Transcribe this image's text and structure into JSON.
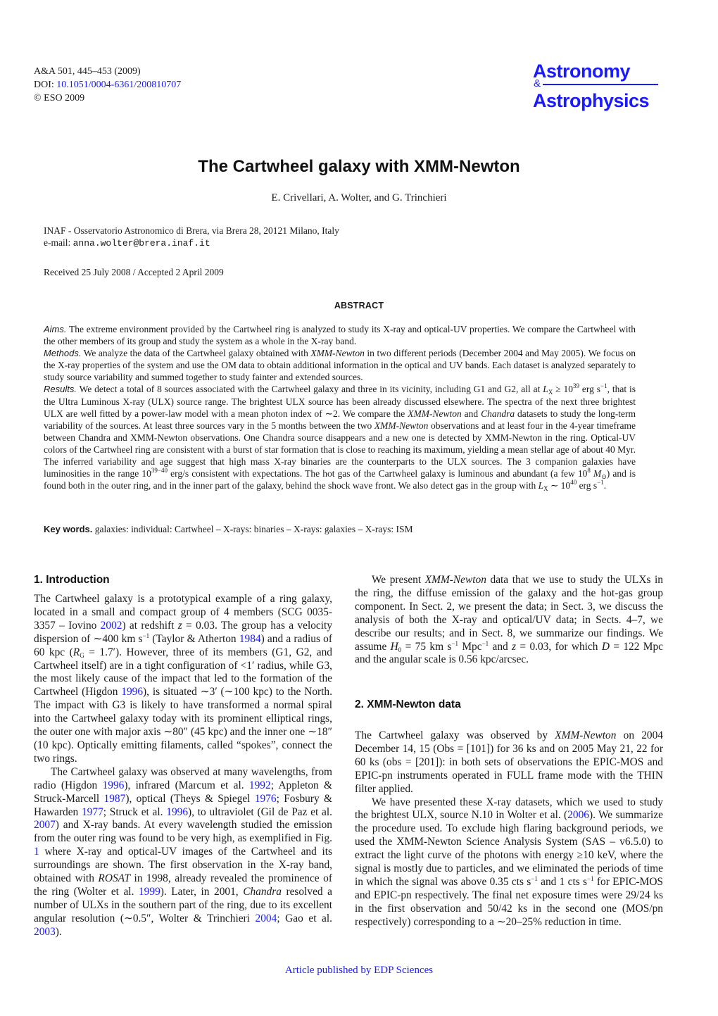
{
  "header": {
    "citation": "A&A 501, 445–453 (2009)",
    "doi_label": "DOI: ",
    "doi_link": "10.1051/0004-6361/200810707",
    "copyright": "© ESO 2009"
  },
  "journal_logo": {
    "line1": "Astronomy",
    "ampersand": "&",
    "line2": "Astrophysics",
    "color": "#1a1aff"
  },
  "paper": {
    "title": "The Cartwheel galaxy with XMM-Newton",
    "authors": "E. Crivellari, A. Wolter, and G. Trinchieri",
    "affiliation": "INAF - Osservatorio Astronomico di Brera, via Brera 28, 20121 Milano, Italy",
    "email_label": "e-mail: ",
    "email": "anna.wolter@brera.inaf.it",
    "received": "Received 25 July 2008 / Accepted 2 April 2009"
  },
  "abstract": {
    "heading": "ABSTRACT",
    "aims_label": "Aims.",
    "aims": "The extreme environment provided by the Cartwheel ring is analyzed to study its X-ray and optical-UV properties. We compare the Cartwheel with the other members of its group and study the system as a whole in the X-ray band.",
    "methods_label": "Methods.",
    "methods_a": "We analyze the data of the Cartwheel galaxy obtained with ",
    "methods_it": "XMM-Newton",
    "methods_b": " in two different periods (December 2004 and May 2005). We focus on the X-ray properties of the system and use the OM data to obtain additional information in the optical and UV bands. Each dataset is analyzed separately to study source variability and summed together to study fainter and extended sources.",
    "results_label": "Results.",
    "results_a": "We detect a total of 8 sources associated with the Cartwheel galaxy and three in its vicinity, including G1 and G2, all at ",
    "results_lx": "L",
    "results_lx_sub": "X",
    "results_b": " ≥ 10",
    "results_b_sup": "39",
    "results_c": " erg s",
    "results_c_sup": "−1",
    "results_d": ", that is the Ultra Luminous X-ray (ULX) source range. The brightest ULX source has been already discussed elsewhere. The spectra of the next three brightest ULX are well fitted by a power-law model with a mean photon index of ∼2. We compare the ",
    "results_it1": "XMM-Newton",
    "results_e": " and ",
    "results_it2": "Chandra",
    "results_f": " datasets to study the long-term variability of the sources. At least three sources vary in the 5 months between the two ",
    "results_it3": "XMM-Newton",
    "results_g": " observations and at least four in the 4-year timeframe between Chandra and XMM-Newton observations. One Chandra source disappears and a new one is detected by XMM-Newton in the ring. Optical-UV colors of the Cartwheel ring are consistent with a burst of star formation that is close to reaching its maximum, yielding a mean stellar age of about 40 Myr. The inferred variability and age suggest that high mass X-ray binaries are the counterparts to the ULX sources. The 3 companion galaxies have luminosities in the range 10",
    "results_g_sup": "39−40",
    "results_h": " erg/s consistent with expectations. The hot gas of the Cartwheel galaxy is luminous and abundant (a few 10",
    "results_h_sup": "8",
    "results_msun": " M",
    "results_msun_sub": "⊙",
    "results_i": ") and is found both in the outer ring, and in the inner part of the galaxy, behind the shock wave front. We also detect gas in the group with ",
    "results_j": " ∼ 10",
    "results_j_sup": "40",
    "results_k": " erg s",
    "results_k_sup": "−1",
    "results_end": ".",
    "keywords_label": "Key words.",
    "keywords": "galaxies: individual: Cartwheel – X-rays: binaries – X-rays: galaxies – X-rays: ISM"
  },
  "section1": {
    "heading": "1. Introduction",
    "p1_a": "The Cartwheel galaxy is a prototypical example of a ring galaxy, located in a small and compact group of 4 members (SCG 0035-3357 – Iovino ",
    "p1_c1": "2002",
    "p1_b": ") at redshift ",
    "p1_z": "z",
    "p1_c": " = 0.03. The group has a velocity dispersion of ∼400 km s",
    "p1_c_sup": "−1",
    "p1_d": " (Taylor & Atherton ",
    "p1_c2": "1984",
    "p1_e": ") and a radius of 60 kpc (",
    "p1_rg": "R",
    "p1_rg_sub": "G",
    "p1_f": " = 1.7′). However, three of its members (G1, G2, and Cartwheel itself) are in a tight configuration of <1′ radius, while G3, the most likely cause of the impact that led to the formation of the Cartwheel (Higdon ",
    "p1_c3": "1996",
    "p1_g": "), is situated ∼3′ (∼100 kpc) to the North. The impact with G3 is likely to have transformed a normal spiral into the Cartwheel galaxy today with its prominent elliptical rings, the outer one with major axis ∼80″ (45 kpc) and the inner one ∼18″ (10 kpc). Optically emitting filaments, called “spokes”, connect the two rings.",
    "p2_a": "The Cartwheel galaxy was observed at many wavelengths, from radio (Higdon ",
    "p2_c1": "1996",
    "p2_b": "), infrared (Marcum et al. ",
    "p2_c2": "1992",
    "p2_c": "; Appleton & Struck-Marcell ",
    "p2_c3": "1987",
    "p2_d": "), optical (Theys & Spiegel ",
    "p2_c4": "1976",
    "p2_e": "; Fosbury & Hawarden ",
    "p2_c5": "1977",
    "p2_f": "; Struck et al. ",
    "p2_c6": "1996",
    "p2_g": "), to ultraviolet (Gil de Paz et al. ",
    "p2_c7": "2007",
    "p2_h": ") and X-ray bands. At every wavelength studied the emission from the outer ring was found to be very high, as exemplified in Fig. ",
    "p2_c8": "1",
    "p2_i": " where X-ray and optical-UV images of the Cartwheel and its surroundings are shown. The first observation in the X-ray band, obtained with ",
    "p2_it1": "ROSAT",
    "p2_j": " in 1998, already revealed the prominence of the ring (Wolter et al. ",
    "p2_c9": "1999",
    "p2_k": "). Later, in 2001, ",
    "p2_it2": "Chandra",
    "p2_l": " resolved a number of ULXs in the southern part of the ring, due to its excellent angular resolution (∼0.5″, Wolter & Trinchieri ",
    "p2_c10": "2004",
    "p2_m": "; Gao et al. ",
    "p2_c11": "2003",
    "p2_n": ").",
    "p3_a": "We present ",
    "p3_it": "XMM-Newton",
    "p3_b": " data that we use to study the ULXs in the ring, the diffuse emission of the galaxy and the hot-gas group component. In Sect. 2, we present the data; in Sect. 3, we discuss the analysis of both the X-ray and optical/UV data; in Sects. 4–7, we describe our results; and in Sect. 8, we summarize our findings. We assume ",
    "p3_h0": "H",
    "p3_h0_sub": "0",
    "p3_c": " = 75 km s",
    "p3_c_sup": "−1",
    "p3_d": " Mpc",
    "p3_d_sup": "−1",
    "p3_e": " and ",
    "p3_z": "z",
    "p3_f": " = 0.03, for which ",
    "p3_dd": "D",
    "p3_g": " = 122 Mpc and the angular scale is 0.56 kpc/arcsec."
  },
  "section2": {
    "heading": "2. XMM-Newton data",
    "p1_a": "The Cartwheel galaxy was observed by ",
    "p1_it": "XMM-Newton",
    "p1_b": " on 2004 December 14, 15 (Obs = [101]) for 36 ks and on 2005 May 21, 22 for 60 ks (obs = [201]): in both sets of observations the EPIC-MOS and EPIC-pn instruments operated in FULL frame mode with the THIN filter applied.",
    "p2_a": "We have presented these X-ray datasets, which we used to study the brightest ULX, source N.10 in Wolter et al. (",
    "p2_c1": "2006",
    "p2_b": "). We summarize the procedure used. To exclude high flaring background periods, we used the XMM-Newton Science Analysis System (SAS – v6.5.0) to extract the light curve of the photons with energy ≥10 keV, where the signal is mostly due to particles, and we eliminated the periods of time in which the signal was above 0.35 cts s",
    "p2_b_sup": "−1",
    "p2_c": " and 1 cts s",
    "p2_c_sup": "−1",
    "p2_d": " for EPIC-MOS and EPIC-pn respectively. The final net exposure times were 29/24 ks in the first observation and 50/42 ks in the second one (MOS/pn respectively) corresponding to a ∼20–25% reduction in time."
  },
  "footer": {
    "text": "Article published by EDP Sciences"
  }
}
